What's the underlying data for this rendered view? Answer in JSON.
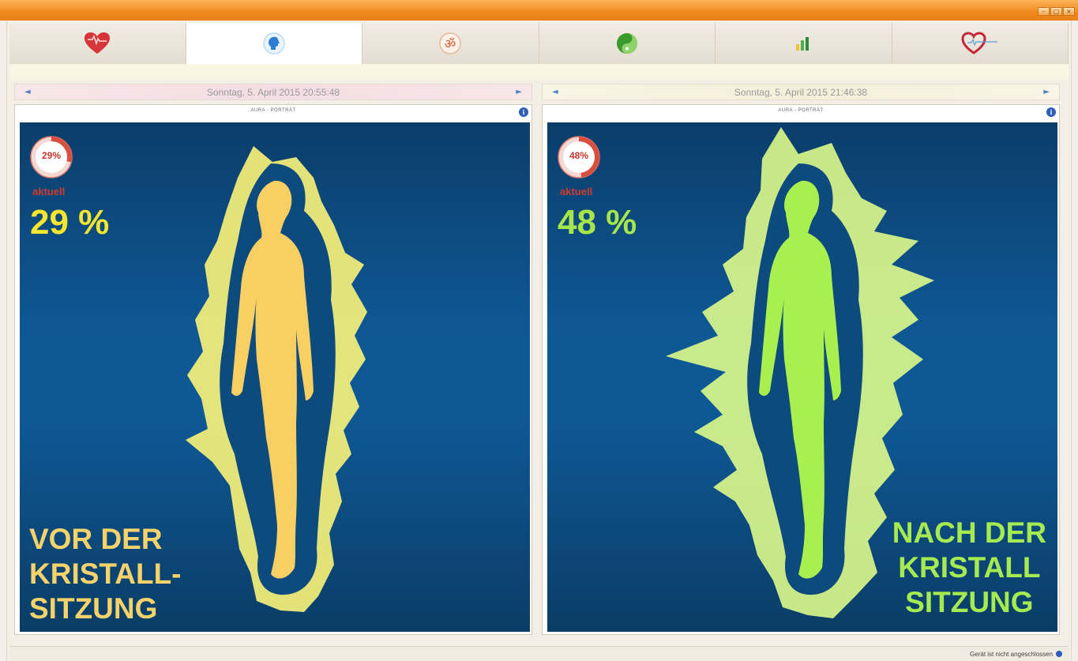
{
  "window": {
    "controls": [
      "minimize",
      "maximize",
      "close"
    ]
  },
  "tabs": [
    {
      "name": "heart-icon",
      "color": "#d6363a"
    },
    {
      "name": "head-profile-icon",
      "color": "#2d7fd6",
      "active": true
    },
    {
      "name": "om-symbol-icon",
      "color": "#d85a2a"
    },
    {
      "name": "yin-yang-icon",
      "color": "#3a9a2e"
    },
    {
      "name": "bar-chart-icon",
      "color": "#4caf50"
    },
    {
      "name": "heart-logo-icon",
      "color": "#c0283a"
    }
  ],
  "panels": [
    {
      "date": "Sonntag, 5. April 2015 20:55:48",
      "card_title": "AURA - PORTRÄT",
      "gauge": {
        "value": 29,
        "label": "29%"
      },
      "status_label": "aktuell",
      "percent_text": "29 %",
      "percent_color": "#f4e52e",
      "caption": [
        "VOR DER",
        "KRISTALL-",
        "SITZUNG"
      ],
      "caption_color": "#f6d36a",
      "body_color": "#f7cf62",
      "aura_color": "#f5f07a"
    },
    {
      "date": "Sonntag, 5. April 2015 21:46:38",
      "card_title": "AURA - PORTRÄT",
      "gauge": {
        "value": 48,
        "label": "48%"
      },
      "status_label": "aktuell",
      "percent_text": "48 %",
      "percent_color": "#a6e64a",
      "caption": [
        "NACH DER",
        "KRISTALL",
        "SITZUNG"
      ],
      "caption_color": "#a6ea52",
      "body_color": "#a9f04e",
      "aura_color": "#d9f68a"
    }
  ],
  "status": {
    "text": "Gerät ist nicht angeschlossen"
  }
}
